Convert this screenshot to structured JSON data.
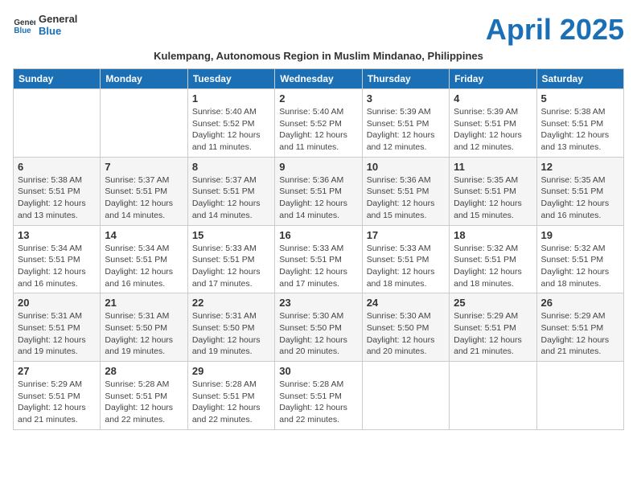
{
  "app": {
    "logo_line1": "General",
    "logo_line2": "Blue"
  },
  "title": "April 2025",
  "subtitle": "Kulempang, Autonomous Region in Muslim Mindanao, Philippines",
  "days_of_week": [
    "Sunday",
    "Monday",
    "Tuesday",
    "Wednesday",
    "Thursday",
    "Friday",
    "Saturday"
  ],
  "weeks": [
    [
      {
        "day": "",
        "info": ""
      },
      {
        "day": "",
        "info": ""
      },
      {
        "day": "1",
        "info": "Sunrise: 5:40 AM\nSunset: 5:52 PM\nDaylight: 12 hours\nand 11 minutes."
      },
      {
        "day": "2",
        "info": "Sunrise: 5:40 AM\nSunset: 5:52 PM\nDaylight: 12 hours\nand 11 minutes."
      },
      {
        "day": "3",
        "info": "Sunrise: 5:39 AM\nSunset: 5:51 PM\nDaylight: 12 hours\nand 12 minutes."
      },
      {
        "day": "4",
        "info": "Sunrise: 5:39 AM\nSunset: 5:51 PM\nDaylight: 12 hours\nand 12 minutes."
      },
      {
        "day": "5",
        "info": "Sunrise: 5:38 AM\nSunset: 5:51 PM\nDaylight: 12 hours\nand 13 minutes."
      }
    ],
    [
      {
        "day": "6",
        "info": "Sunrise: 5:38 AM\nSunset: 5:51 PM\nDaylight: 12 hours\nand 13 minutes."
      },
      {
        "day": "7",
        "info": "Sunrise: 5:37 AM\nSunset: 5:51 PM\nDaylight: 12 hours\nand 14 minutes."
      },
      {
        "day": "8",
        "info": "Sunrise: 5:37 AM\nSunset: 5:51 PM\nDaylight: 12 hours\nand 14 minutes."
      },
      {
        "day": "9",
        "info": "Sunrise: 5:36 AM\nSunset: 5:51 PM\nDaylight: 12 hours\nand 14 minutes."
      },
      {
        "day": "10",
        "info": "Sunrise: 5:36 AM\nSunset: 5:51 PM\nDaylight: 12 hours\nand 15 minutes."
      },
      {
        "day": "11",
        "info": "Sunrise: 5:35 AM\nSunset: 5:51 PM\nDaylight: 12 hours\nand 15 minutes."
      },
      {
        "day": "12",
        "info": "Sunrise: 5:35 AM\nSunset: 5:51 PM\nDaylight: 12 hours\nand 16 minutes."
      }
    ],
    [
      {
        "day": "13",
        "info": "Sunrise: 5:34 AM\nSunset: 5:51 PM\nDaylight: 12 hours\nand 16 minutes."
      },
      {
        "day": "14",
        "info": "Sunrise: 5:34 AM\nSunset: 5:51 PM\nDaylight: 12 hours\nand 16 minutes."
      },
      {
        "day": "15",
        "info": "Sunrise: 5:33 AM\nSunset: 5:51 PM\nDaylight: 12 hours\nand 17 minutes."
      },
      {
        "day": "16",
        "info": "Sunrise: 5:33 AM\nSunset: 5:51 PM\nDaylight: 12 hours\nand 17 minutes."
      },
      {
        "day": "17",
        "info": "Sunrise: 5:33 AM\nSunset: 5:51 PM\nDaylight: 12 hours\nand 18 minutes."
      },
      {
        "day": "18",
        "info": "Sunrise: 5:32 AM\nSunset: 5:51 PM\nDaylight: 12 hours\nand 18 minutes."
      },
      {
        "day": "19",
        "info": "Sunrise: 5:32 AM\nSunset: 5:51 PM\nDaylight: 12 hours\nand 18 minutes."
      }
    ],
    [
      {
        "day": "20",
        "info": "Sunrise: 5:31 AM\nSunset: 5:51 PM\nDaylight: 12 hours\nand 19 minutes."
      },
      {
        "day": "21",
        "info": "Sunrise: 5:31 AM\nSunset: 5:50 PM\nDaylight: 12 hours\nand 19 minutes."
      },
      {
        "day": "22",
        "info": "Sunrise: 5:31 AM\nSunset: 5:50 PM\nDaylight: 12 hours\nand 19 minutes."
      },
      {
        "day": "23",
        "info": "Sunrise: 5:30 AM\nSunset: 5:50 PM\nDaylight: 12 hours\nand 20 minutes."
      },
      {
        "day": "24",
        "info": "Sunrise: 5:30 AM\nSunset: 5:50 PM\nDaylight: 12 hours\nand 20 minutes."
      },
      {
        "day": "25",
        "info": "Sunrise: 5:29 AM\nSunset: 5:51 PM\nDaylight: 12 hours\nand 21 minutes."
      },
      {
        "day": "26",
        "info": "Sunrise: 5:29 AM\nSunset: 5:51 PM\nDaylight: 12 hours\nand 21 minutes."
      }
    ],
    [
      {
        "day": "27",
        "info": "Sunrise: 5:29 AM\nSunset: 5:51 PM\nDaylight: 12 hours\nand 21 minutes."
      },
      {
        "day": "28",
        "info": "Sunrise: 5:28 AM\nSunset: 5:51 PM\nDaylight: 12 hours\nand 22 minutes."
      },
      {
        "day": "29",
        "info": "Sunrise: 5:28 AM\nSunset: 5:51 PM\nDaylight: 12 hours\nand 22 minutes."
      },
      {
        "day": "30",
        "info": "Sunrise: 5:28 AM\nSunset: 5:51 PM\nDaylight: 12 hours\nand 22 minutes."
      },
      {
        "day": "",
        "info": ""
      },
      {
        "day": "",
        "info": ""
      },
      {
        "day": "",
        "info": ""
      }
    ]
  ]
}
